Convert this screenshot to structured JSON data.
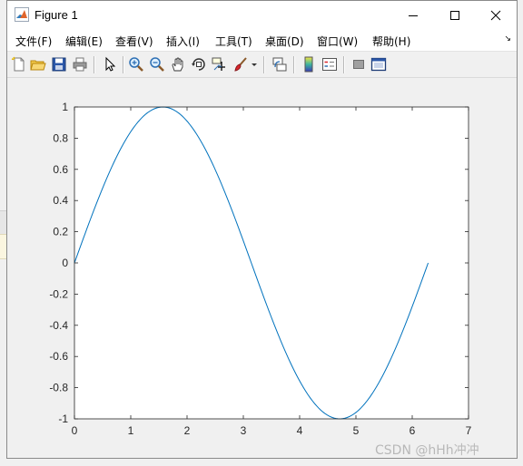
{
  "window": {
    "title": "Figure 1"
  },
  "menu": {
    "items": [
      "文件(F)",
      "编辑(E)",
      "查看(V)",
      "插入(I)",
      "工具(T)",
      "桌面(D)",
      "窗口(W)",
      "帮助(H)"
    ]
  },
  "toolbar": {
    "icons": [
      "new-figure-icon",
      "open-file-icon",
      "save-icon",
      "print-icon",
      "select-arrow-icon",
      "zoom-in-icon",
      "zoom-out-icon",
      "pan-hand-icon",
      "rotate-3d-icon",
      "data-cursor-icon",
      "brush-icon",
      "brush-dropdown-icon",
      "link-plot-icon",
      "insert-colorbar-icon",
      "insert-legend-icon",
      "hide-plot-tools-icon",
      "show-plot-tools-icon"
    ]
  },
  "chart_data": {
    "type": "line",
    "function": "sin(x)",
    "x": [
      0,
      0.25,
      0.5,
      0.75,
      1.0,
      1.25,
      1.5,
      1.5708,
      1.75,
      2.0,
      2.25,
      2.5,
      2.75,
      3.0,
      3.1416,
      3.25,
      3.5,
      3.75,
      4.0,
      4.25,
      4.5,
      4.7124,
      4.75,
      5.0,
      5.25,
      5.5,
      5.75,
      6.0,
      6.2832
    ],
    "y": [
      0,
      0.247,
      0.479,
      0.682,
      0.841,
      0.949,
      0.997,
      1.0,
      0.984,
      0.909,
      0.778,
      0.598,
      0.382,
      0.141,
      0.0,
      -0.108,
      -0.351,
      -0.572,
      -0.757,
      -0.895,
      -0.978,
      -1.0,
      -0.999,
      -0.959,
      -0.859,
      -0.706,
      -0.509,
      -0.279,
      0.0
    ],
    "xlim": [
      0,
      7
    ],
    "ylim": [
      -1,
      1
    ],
    "xticks": [
      "0",
      "1",
      "2",
      "3",
      "4",
      "5",
      "6",
      "7"
    ],
    "yticks": [
      "-1",
      "-0.8",
      "-0.6",
      "-0.4",
      "-0.2",
      "0",
      "0.2",
      "0.4",
      "0.6",
      "0.8",
      "1"
    ],
    "line_color": "#0072bd",
    "grid": false,
    "title": "",
    "xlabel": "",
    "ylabel": ""
  },
  "watermark": "CSDN @hHh冲冲"
}
